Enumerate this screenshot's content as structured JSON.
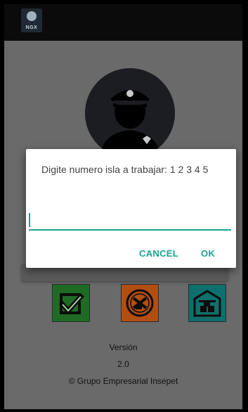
{
  "app": {
    "logo_text": "NGX"
  },
  "dialog": {
    "message": "Digite numero isla a trabajar:  1 2 3 4 5",
    "input_value": "",
    "cancel_label": "CANCEL",
    "ok_label": "OK"
  },
  "footer": {
    "version_label": "Versión",
    "version_value": "2.0",
    "copyright": "© Grupo Empresarial Insepet"
  },
  "colors": {
    "accent": "#1aa394",
    "tile_green": "#1f6b25",
    "tile_orange": "#b14e12",
    "tile_teal": "#0f6f6c",
    "dim_background": "#6a6a6a"
  },
  "icons": [
    "app-logo-icon",
    "security-guard-avatar-icon",
    "approve-check-icon",
    "maintenance-tools-icon",
    "warehouse-icon"
  ]
}
